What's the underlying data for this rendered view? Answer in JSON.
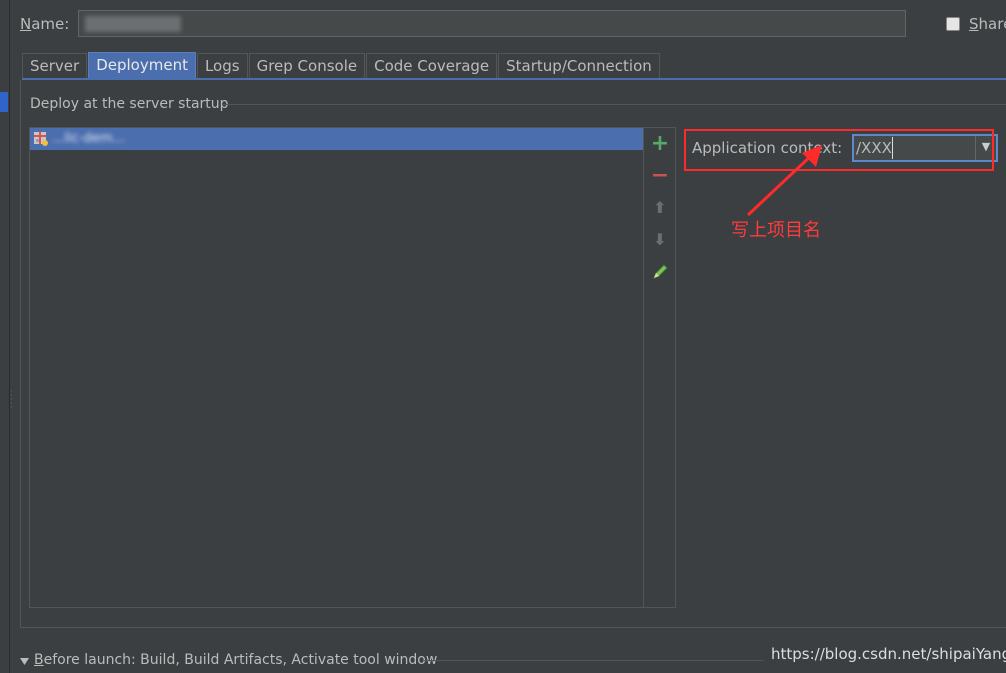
{
  "name_row": {
    "label_mnemonic": "N",
    "label_rest": "ame:",
    "share_mnemonic": "S",
    "share_rest": "hare"
  },
  "tabs": [
    {
      "label": "Server",
      "active": false
    },
    {
      "label": "Deployment",
      "active": true
    },
    {
      "label": "Logs",
      "active": false
    },
    {
      "label": "Grep Console",
      "active": false
    },
    {
      "label": "Code Coverage",
      "active": false
    },
    {
      "label": "Startup/Connection",
      "active": false
    }
  ],
  "deployment": {
    "section_title": "Deploy at the server startup",
    "artifact_label": "...lic-dem..."
  },
  "toolbar": {
    "add_glyph": "+",
    "remove_glyph": "−",
    "up_glyph": "⬆",
    "down_glyph": "⬇"
  },
  "context": {
    "label": "Application context:",
    "value": "/XXX",
    "dropdown_glyph": "▼"
  },
  "annotation": {
    "text": "写上项目名",
    "color": "#ff3b3b"
  },
  "before_launch": {
    "mnemonic": "B",
    "rest": "efore launch: Build, Build Artifacts, Activate tool window"
  },
  "watermark": "https://blog.csdn.net/shipaiYang",
  "colors": {
    "background": "#3c3f41",
    "selection": "#4b6eaf",
    "highlight": "#ff2a2a"
  }
}
